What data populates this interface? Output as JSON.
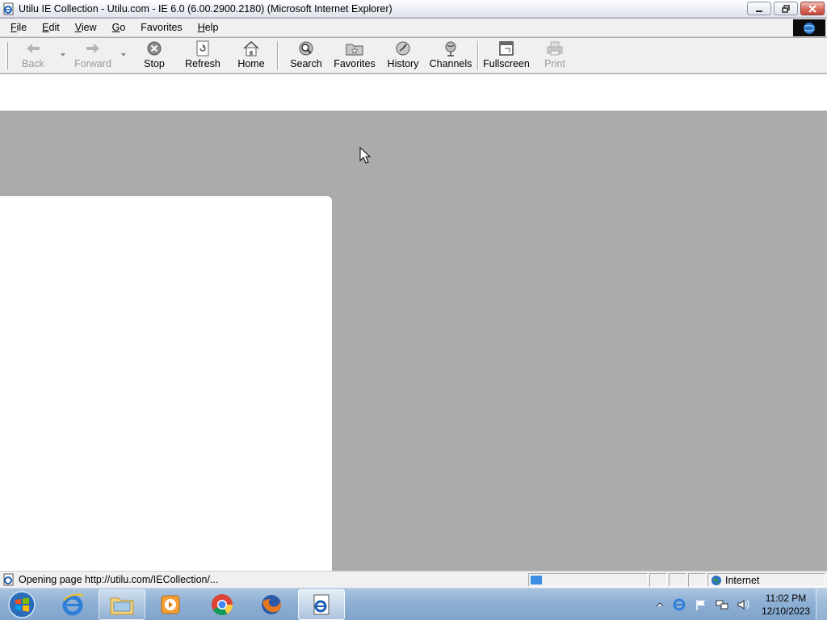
{
  "window": {
    "title": "Utilu IE Collection - Utilu.com - IE 6.0 (6.00.2900.2180) (Microsoft Internet Explorer)"
  },
  "menu": {
    "items": [
      {
        "key": "F",
        "rest": "ile"
      },
      {
        "key": "E",
        "rest": "dit"
      },
      {
        "key": "V",
        "rest": "iew"
      },
      {
        "key": "G",
        "rest": "o"
      },
      {
        "key": "",
        "rest": "Favorites"
      },
      {
        "key": "H",
        "rest": "elp"
      }
    ]
  },
  "toolbar": {
    "back": "Back",
    "forward": "Forward",
    "stop": "Stop",
    "refresh": "Refresh",
    "home": "Home",
    "search": "Search",
    "favorites": "Favorites",
    "history": "History",
    "channels": "Channels",
    "fullscreen": "Fullscreen",
    "print": "Print"
  },
  "status": {
    "text": "Opening page http://utilu.com/IECollection/...",
    "zone": "Internet",
    "progress": 0.1
  },
  "taskbar": {
    "apps": [
      "internet-explorer",
      "windows-explorer",
      "media-player",
      "chrome",
      "firefox",
      "internet-explorer-6"
    ],
    "time": "11:02 PM",
    "date": "12/10/2023"
  },
  "colors": {
    "page_background": "#ababab",
    "taskbar": "#8fb0d4",
    "progress": "#3d8ee6"
  }
}
